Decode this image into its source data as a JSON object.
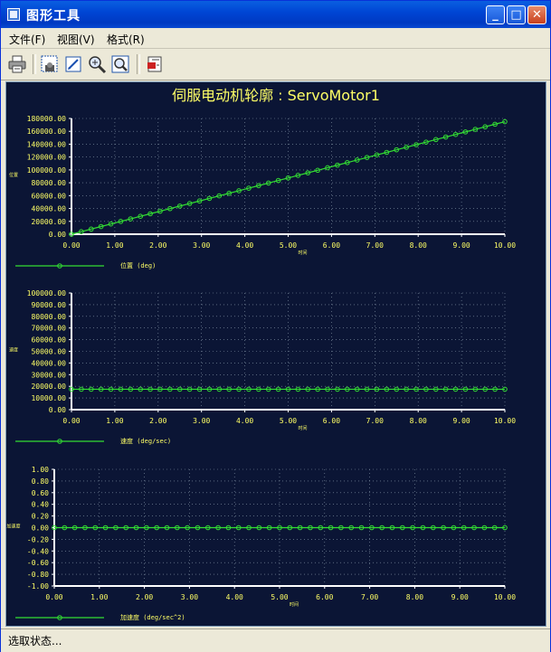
{
  "window": {
    "title": "图形工具"
  },
  "menu": [
    {
      "label": "文件(F)"
    },
    {
      "label": "视图(V)"
    },
    {
      "label": "格式(R)"
    }
  ],
  "toolbar": {
    "tools": [
      "print-icon",
      "grid-view-icon",
      "edit-icon",
      "zoom-in-icon",
      "zoom-fit-icon",
      "export-icon"
    ]
  },
  "colors": {
    "background": "#0b1535",
    "text": "#ffff66",
    "axis": "#ffffff",
    "series": "#33dd33",
    "grid": "#8899aa"
  },
  "chart_title": "伺服电动机轮廓 : ServoMotor1",
  "chart_data": [
    {
      "type": "line",
      "x_ticks": [
        "0.00",
        "1.00",
        "2.00",
        "3.00",
        "4.00",
        "5.00",
        "6.00",
        "7.00",
        "8.00",
        "9.00",
        "10.00"
      ],
      "y_ticks": [
        "0.00",
        "20000.00",
        "40000.00",
        "60000.00",
        "80000.00",
        "100000.00",
        "120000.00",
        "140000.00",
        "160000.00",
        "180000.00"
      ],
      "xlabel": "时间",
      "ylabel": "位置",
      "legend": "位置 (deg)",
      "xlim": [
        0,
        10
      ],
      "ylim": [
        0,
        180000
      ],
      "series": [
        {
          "name": "位置 (deg)",
          "x_start": 0,
          "x_end": 10,
          "y_start": 0,
          "y_end": 175000,
          "points": 45
        }
      ]
    },
    {
      "type": "line",
      "x_ticks": [
        "0.00",
        "1.00",
        "2.00",
        "3.00",
        "4.00",
        "5.00",
        "6.00",
        "7.00",
        "8.00",
        "9.00",
        "10.00"
      ],
      "y_ticks": [
        "0.00",
        "10000.00",
        "20000.00",
        "30000.00",
        "40000.00",
        "50000.00",
        "60000.00",
        "70000.00",
        "80000.00",
        "90000.00",
        "100000.00"
      ],
      "xlabel": "时间",
      "ylabel": "速度",
      "legend": "速度 (deg/sec)",
      "xlim": [
        0,
        10
      ],
      "ylim": [
        0,
        100000
      ],
      "series": [
        {
          "name": "速度 (deg/sec)",
          "x_start": 0,
          "x_end": 10,
          "y_start": 17500,
          "y_end": 17500,
          "points": 45
        }
      ]
    },
    {
      "type": "line",
      "x_ticks": [
        "0.00",
        "1.00",
        "2.00",
        "3.00",
        "4.00",
        "5.00",
        "6.00",
        "7.00",
        "8.00",
        "9.00",
        "10.00"
      ],
      "y_ticks": [
        "-1.00",
        "-0.80",
        "-0.60",
        "-0.40",
        "-0.20",
        "0.00",
        "0.20",
        "0.40",
        "0.60",
        "0.80",
        "1.00"
      ],
      "xlabel": "时间",
      "ylabel": "加速度",
      "legend": "加速度 (deg/sec^2)",
      "xlim": [
        0,
        10
      ],
      "ylim": [
        -1,
        1
      ],
      "series": [
        {
          "name": "加速度 (deg/sec^2)",
          "x_start": 0,
          "x_end": 10,
          "y_start": 0,
          "y_end": 0,
          "points": 45
        }
      ]
    }
  ],
  "status": {
    "text": "选取状态..."
  }
}
